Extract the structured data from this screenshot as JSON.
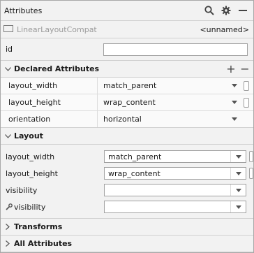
{
  "header": {
    "title": "Attributes",
    "icons": [
      "search-icon",
      "gear-icon",
      "minimize-icon"
    ]
  },
  "component": {
    "name": "LinearLayoutCompat",
    "id": "<unnamed>",
    "icon": "layout-icon"
  },
  "id_field": {
    "label": "id",
    "value": ""
  },
  "declared": {
    "title": "Declared Attributes",
    "add_icon": "+",
    "remove_icon": "−",
    "rows": [
      {
        "label": "layout_width",
        "value": "match_parent"
      },
      {
        "label": "layout_height",
        "value": "wrap_content"
      },
      {
        "label": "orientation",
        "value": "horizontal"
      }
    ]
  },
  "layout": {
    "title": "Layout",
    "rows": [
      {
        "label": "layout_width",
        "value": "match_parent"
      },
      {
        "label": "layout_height",
        "value": "wrap_content"
      },
      {
        "label": "visibility",
        "value": ""
      },
      {
        "label": "visibility",
        "value": "",
        "icon": "wrench-icon"
      }
    ]
  },
  "sections": [
    {
      "title": "Transforms"
    },
    {
      "title": "All Attributes"
    }
  ],
  "colors": {
    "panel_bg": "#f2f2f2",
    "border": "#a8a8a8",
    "muted_text": "#9b9b9b"
  }
}
